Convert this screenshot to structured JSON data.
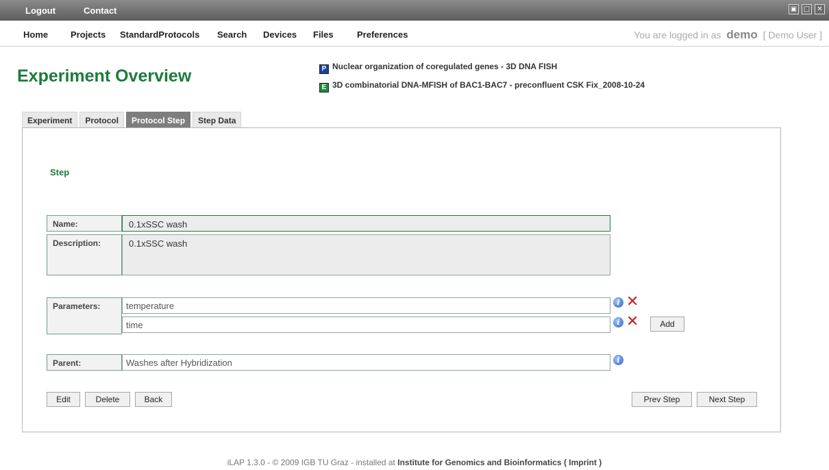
{
  "topbar": {
    "logout": "Logout",
    "contact": "Contact",
    "win_restore": "▣",
    "win_max": "□",
    "win_close": "✕"
  },
  "nav": {
    "home": "Home",
    "projects": "Projects",
    "standard_protocols": "StandardProtocols",
    "search": "Search",
    "devices": "Devices",
    "files": "Files",
    "preferences": "Preferences"
  },
  "login": {
    "prefix": "You are logged in as",
    "user": "demo",
    "display_name": "[ Demo User ]"
  },
  "page": {
    "title": "Experiment Overview",
    "project_icon": "P",
    "project_link": "Nuclear organization of coregulated genes - 3D DNA FISH",
    "experiment_icon": "E",
    "experiment_link": "3D combinatorial DNA-MFISH of BAC1-BAC7 - preconfluent CSK Fix_2008-10-24"
  },
  "tabs": [
    "Experiment",
    "Protocol",
    "Protocol Step",
    "Step Data"
  ],
  "step": {
    "heading": "Step",
    "name_label": "Name:",
    "name_value": "0.1xSSC wash",
    "description_label": "Description:",
    "description_value": "0.1xSSC wash",
    "parameters_label": "Parameters:",
    "parameters": [
      "temperature",
      "time"
    ],
    "parent_label": "Parent:",
    "parent_value": "Washes after Hybridization"
  },
  "icons": {
    "info_glyph": "i",
    "delete_glyph": "✕"
  },
  "buttons": {
    "add": "Add",
    "edit": "Edit",
    "delete": "Delete",
    "back": "Back",
    "prev_step": "Prev Step",
    "next_step": "Next Step"
  },
  "footer": {
    "prefix": "iLAP 1.3.0 - © 2009 IGB TU Graz - installed at",
    "institute": "Institute for Genomics and Bioinformatics",
    "imprint": "( Imprint )"
  }
}
